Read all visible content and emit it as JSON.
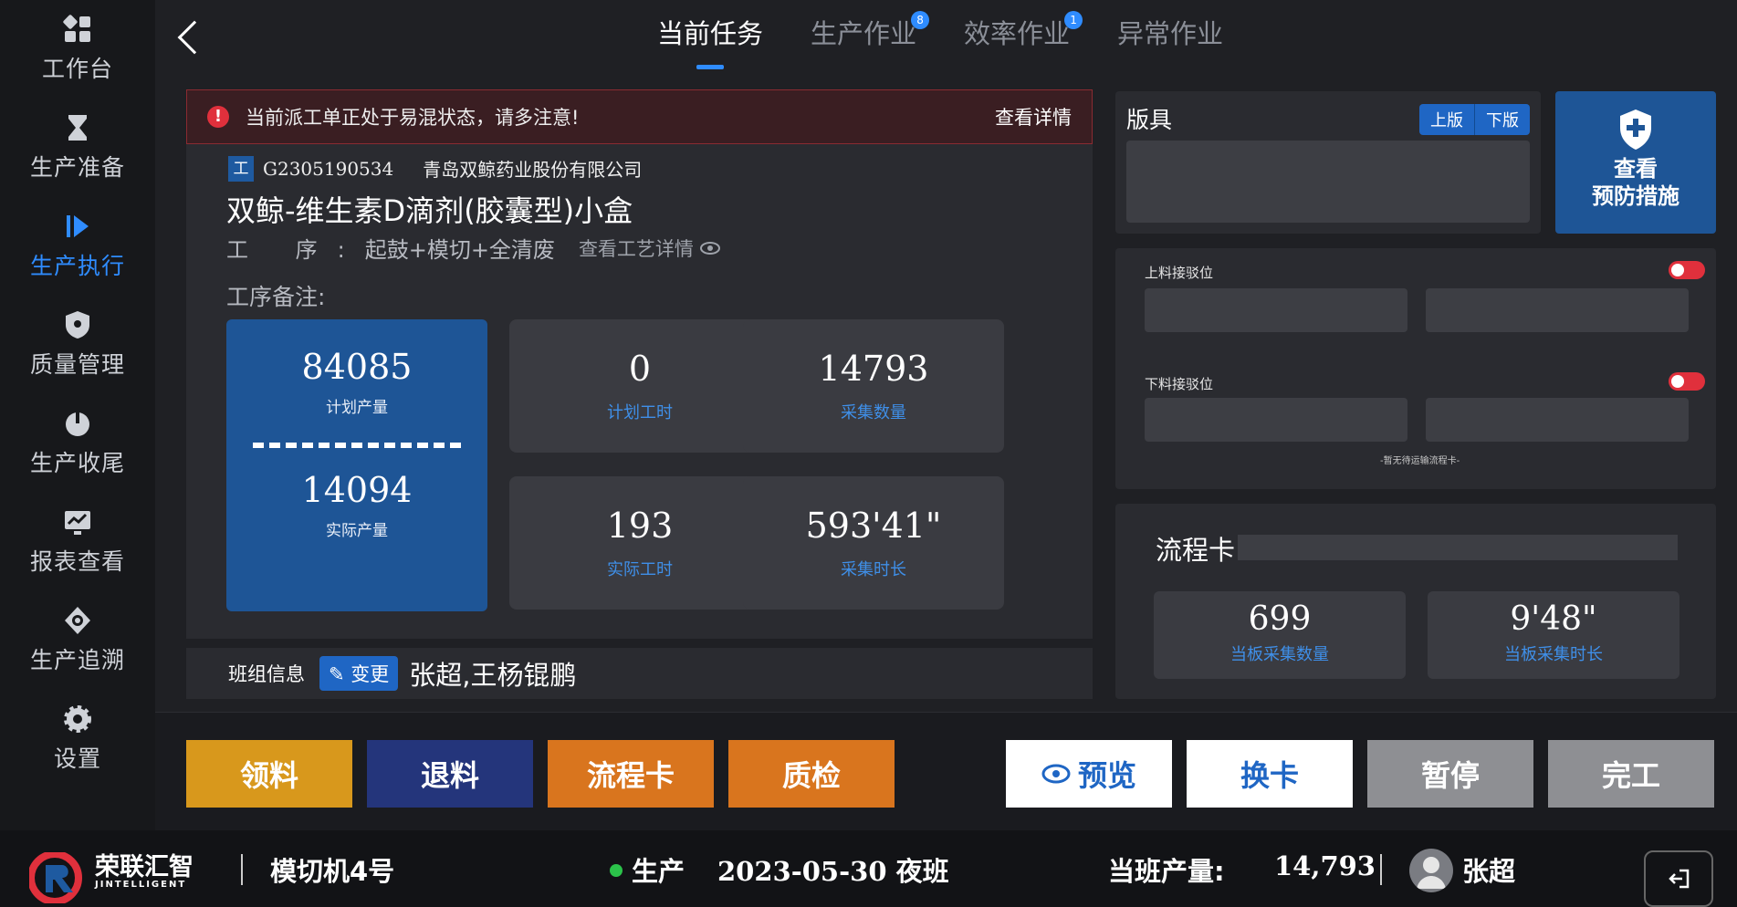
{
  "sidebar": {
    "items": [
      {
        "label": "工作台",
        "icon": "grid-icon"
      },
      {
        "label": "生产准备",
        "icon": "hourglass-icon"
      },
      {
        "label": "生产执行",
        "icon": "play-icon"
      },
      {
        "label": "质量管理",
        "icon": "shield-icon"
      },
      {
        "label": "生产收尾",
        "icon": "power-icon"
      },
      {
        "label": "报表查看",
        "icon": "chart-icon"
      },
      {
        "label": "生产追溯",
        "icon": "trace-icon"
      },
      {
        "label": "设置",
        "icon": "gear-icon"
      }
    ],
    "active_index": 2
  },
  "tabs": [
    {
      "label": "当前任务",
      "badge": ""
    },
    {
      "label": "生产作业",
      "badge": "8"
    },
    {
      "label": "效率作业",
      "badge": "1"
    },
    {
      "label": "异常作业",
      "badge": ""
    }
  ],
  "warning": {
    "text": "当前派工单正处于易混状态，请多注意!",
    "link": "查看详情"
  },
  "task": {
    "tag": "工",
    "order_no": "G2305190534",
    "company": "青岛双鲸药业股份有限公司",
    "product": "双鲸-维生素D滴剂(胶囊型)小盒",
    "process_key": "工 序:",
    "process_value": "起鼓+模切+全清废",
    "process_detail": "查看工艺详情",
    "remark_label": "工序备注:"
  },
  "stats": {
    "plan_output": {
      "value": "84085",
      "label": "计划产量"
    },
    "actual_output": {
      "value": "14094",
      "label": "实际产量"
    },
    "plan_hours": {
      "value": "0",
      "label": "计划工时"
    },
    "collect_qty": {
      "value": "14793",
      "label": "采集数量"
    },
    "actual_hours": {
      "value": "193",
      "label": "实际工时"
    },
    "collect_time": {
      "value": "593'41\"",
      "label": "采集时长"
    }
  },
  "crew": {
    "label": "班组信息",
    "change": "变更",
    "names": "张超,王杨锟鹏"
  },
  "plate": {
    "title": "版具",
    "btn_up": "上版",
    "btn_down": "下版"
  },
  "prevent": {
    "line1": "查看",
    "line2": "预防措施"
  },
  "feed": {
    "load_label": "上料接驳位",
    "unload_label": "下料接驳位",
    "note": "-暂无待运输流程卡-"
  },
  "flowcard": {
    "title": "流程卡",
    "board_qty": {
      "value": "699",
      "label": "当板采集数量"
    },
    "board_time": {
      "value": "9'48\"",
      "label": "当板采集时长"
    }
  },
  "actions": {
    "pick": "领料",
    "return": "退料",
    "flow": "流程卡",
    "qc": "质检",
    "preview": "预览",
    "swap": "换卡",
    "pause": "暂停",
    "finish": "完工"
  },
  "footer": {
    "brand": "荣联汇智",
    "brand_sub": "JINTELLIGENT",
    "machine": "模切机4号",
    "status": "生产",
    "date_shift": "2023-05-30 夜班",
    "shift_output_label": "当班产量:",
    "shift_output_value": "14,793",
    "user": "张超"
  },
  "colors": {
    "accent": "#1f66c4",
    "warning": "#e0303c",
    "pick": "#d8981c",
    "return": "#24357b",
    "flow": "#d9751e"
  }
}
